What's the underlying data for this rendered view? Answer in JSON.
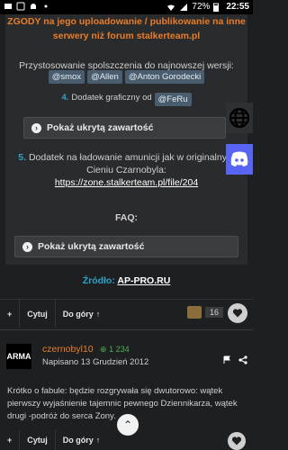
{
  "status": {
    "battery": "72%",
    "time": "22:55"
  },
  "post1": {
    "warning": "ZGODY na jego uploadowanie / publikowanie na inne serwery niż forum stalkerteam.pl",
    "applied_text": "Przystosowanie spolszczenia do najnowszej wersji:",
    "mentions": [
      "@smox",
      "@Allen",
      "@Anton Gorodecki"
    ],
    "item4_num": "4.",
    "item4_text": "Dodatek graficzny od",
    "item4_mention": "@FeRu",
    "spoiler1": "Pokaż ukrytą zawartość",
    "item5_num": "5.",
    "item5_text": "Dodatek na ładowanie amunicji jak w originalnym Cieniu Czarnobyla:",
    "item5_link": "https://zone.stalkerteam.pl/file/204",
    "faq": "FAQ:",
    "spoiler2": "Pokaż ukrytą zawartość",
    "source_label": "Źródło:",
    "source_value": "AP-PRO.RU"
  },
  "actions": {
    "quote": "Cytuj",
    "top": "Do góry",
    "reactions_count": "16"
  },
  "post2": {
    "avatar_text": "ARMA",
    "username": "czernobyl10",
    "reputation": "1 234",
    "date": "Napisano 13 Grudzień 2012",
    "body": "Krótko o fabule: będzie rozgrywała się dwutorowo: wątek pierwszy wyjaśnienie tajemnic pewnego Dziennikarza, wątek drugi -podróż do serca Zony."
  },
  "colors": {
    "accent_orange": "#e77d2b",
    "accent_blue": "#2ea3c6",
    "bg": "#1e1f21"
  }
}
